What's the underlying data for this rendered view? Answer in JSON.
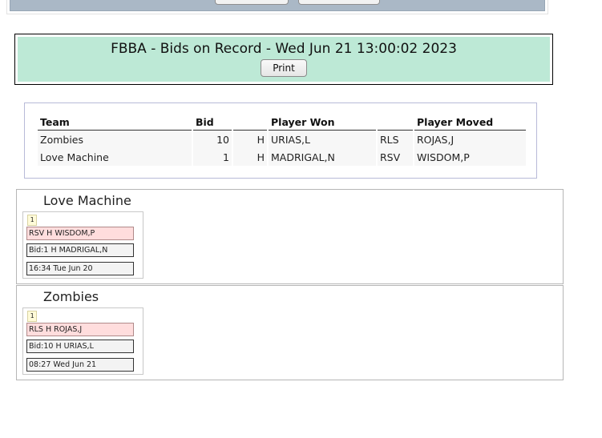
{
  "header": {
    "title": "FBBA - Bids on Record - Wed Jun 21 13:00:02 2023",
    "print_label": "Print"
  },
  "bids_table": {
    "columns": [
      "Team",
      "Bid",
      "",
      "Player Won",
      "",
      "Player Moved"
    ],
    "rows": [
      {
        "team": "Zombies",
        "bid": "10",
        "side": "H",
        "player_won": "URIAS,L",
        "move_type": "RLS",
        "player_moved": "ROJAS,J"
      },
      {
        "team": "Love Machine",
        "bid": "1",
        "side": "H",
        "player_won": "MADRIGAL,N",
        "move_type": "RSV",
        "player_moved": "WISDOM,P"
      }
    ]
  },
  "teams": [
    {
      "name": "Love Machine",
      "count": "1",
      "move_line": "RSV H WISDOM,P",
      "bid_line": "Bid:1 H MADRIGAL,N",
      "time_line": "16:34 Tue Jun 20"
    },
    {
      "name": "Zombies",
      "count": "1",
      "move_line": "RLS H ROJAS,J",
      "bid_line": "Bid:10 H URIAS,L",
      "time_line": "08:27 Wed Jun 21"
    }
  ]
}
